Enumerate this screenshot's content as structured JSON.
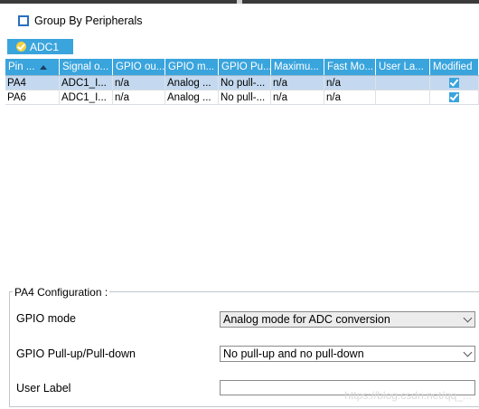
{
  "group_by": {
    "label": "Group By Peripherals",
    "checked": false
  },
  "tab": {
    "label": "ADC1"
  },
  "table": {
    "columns": [
      "Pin ...",
      "Signal o...",
      "GPIO ou...",
      "GPIO m...",
      "GPIO Pu...",
      "Maximu...",
      "Fast Mo...",
      "User La...",
      "Modified"
    ],
    "rows": [
      {
        "cells": [
          "PA4",
          "ADC1_I...",
          "n/a",
          "Analog ...",
          "No pull-...",
          "n/a",
          "n/a",
          ""
        ],
        "modified": true,
        "selected": true
      },
      {
        "cells": [
          "PA6",
          "ADC1_I...",
          "n/a",
          "Analog ...",
          "No pull-...",
          "n/a",
          "n/a",
          ""
        ],
        "modified": true,
        "selected": false
      }
    ]
  },
  "config": {
    "title": "PA4 Configuration :",
    "gpio_mode_label": "GPIO mode",
    "gpio_mode_value": "Analog mode for ADC conversion",
    "pull_label": "GPIO Pull-up/Pull-down",
    "pull_value": "No pull-up and no pull-down",
    "user_label_label": "User Label",
    "user_label_value": ""
  },
  "watermark": "https://blog.csdn.net/qq_..."
}
